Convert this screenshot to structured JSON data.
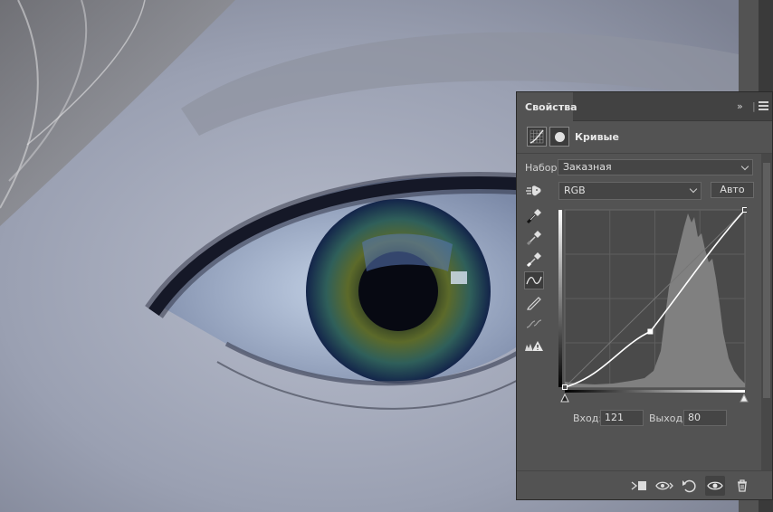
{
  "panel": {
    "tab_label": "Свойства",
    "collapse_label": "»",
    "adjustment_title": "Кривые"
  },
  "preset": {
    "label": "Набор:",
    "value": "Заказная"
  },
  "channel": {
    "value": "RGB",
    "auto_label": "Авто"
  },
  "curve": {
    "input_label": "Вход:",
    "input_value": "121",
    "output_label": "Выход:",
    "output_value": "80",
    "points": [
      [
        0,
        0
      ],
      [
        121,
        80
      ],
      [
        255,
        255
      ]
    ]
  },
  "icons": {
    "tools": [
      "targeted-adjustment-icon",
      "black-point-eyedropper-icon",
      "gray-point-eyedropper-icon",
      "white-point-eyedropper-icon",
      "curve-points-icon",
      "pencil-draw-icon",
      "smooth-curve-icon",
      "clipping-warning-icon"
    ],
    "footer": [
      "clip-to-layer-icon",
      "view-previous-state-icon",
      "reset-adjustment-icon",
      "toggle-visibility-icon",
      "delete-adjustment-icon"
    ]
  },
  "colors": {
    "panel_bg": "#535353",
    "panel_dark": "#424242",
    "graph_bg": "#4a4a4a",
    "histogram": "#808080",
    "curve": "#ffffff"
  }
}
